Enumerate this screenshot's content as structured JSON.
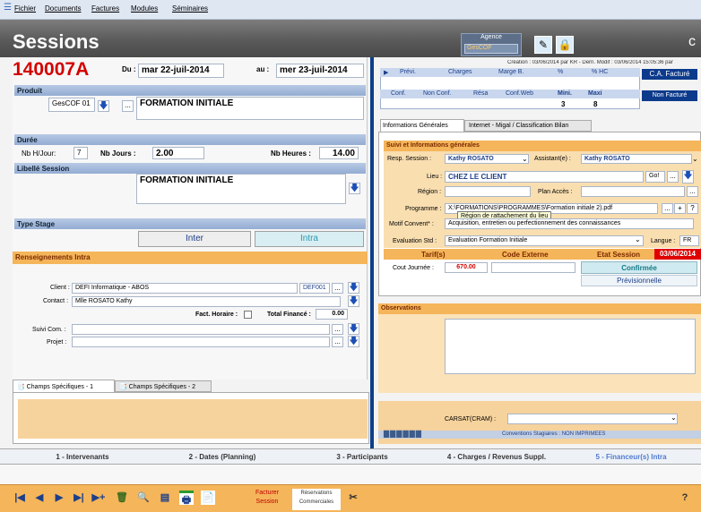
{
  "menu": {
    "items": [
      "Fichier",
      "Documents",
      "Factures",
      "Modules",
      "Séminaires"
    ]
  },
  "header": {
    "title": "Sessions",
    "agence_label": "Agence",
    "agence_value": "GesCOF"
  },
  "session": {
    "number": "140007A",
    "du_label": "Du :",
    "du_value": "mar 22-juil-2014",
    "au_label": "au :",
    "au_value": "mer 23-juil-2014"
  },
  "produit": {
    "header": "Produit",
    "code": "GesCOF 01",
    "name": "FORMATION INITIALE"
  },
  "duree": {
    "header": "Durée",
    "nbh_label": "Nb H/Jour:",
    "nbh_value": "7",
    "nbj_label": "Nb Jours :",
    "nbj_value": "2.00",
    "nbheures_label": "Nb Heures :",
    "nbheures_value": "14.00"
  },
  "libelle": {
    "header": "Libellé Session",
    "value": "FORMATION INITIALE"
  },
  "type_stage": {
    "header": "Type Stage",
    "inter": "Inter",
    "intra": "Intra"
  },
  "intra": {
    "header": "Renseignements Intra",
    "client_label": "Client :",
    "client_value": "DEFI Informatique - ABOS",
    "client_code": "DEF001",
    "contact_label": "Contact :",
    "contact_value": "Mlle ROSATO Kathy",
    "fact_label": "Fact. Horaire :",
    "total_label": "Total Financé :",
    "total_value": "0.00",
    "suivi_label": "Suivi Com. :",
    "projet_label": "Projet :"
  },
  "bottom_tabs": [
    "Champs Spécifiques - 1",
    "Champs Spécifiques - 2"
  ],
  "right": {
    "creation": "Création : 03/06/2014 par KR - Dern. Modif : 03/06/2014 15:05:36 par",
    "grid_headers": [
      "Prévi.",
      "Charges",
      "Marge B.",
      "%",
      "% HC"
    ],
    "grid2_headers": [
      "Conf.",
      "Non Conf.",
      "Résa",
      "Conf.Web",
      "Mini.",
      "Maxi"
    ],
    "mini": "3",
    "maxi": "8",
    "ca_facture": "C.A. Facturé",
    "non_facture": "Non Facturé",
    "tabs": [
      "Informations Générales",
      "Internet - Migal / Classification Bilan"
    ],
    "suivi_header": "Suivi et Informations générales",
    "resp_label": "Resp. Session :",
    "resp_value": "Kathy ROSATO",
    "assist_label": "Assistant(e) :",
    "assist_value": "Kathy ROSATO",
    "lieu_label": "Lieu :",
    "lieu_value": "CHEZ LE CLIENT",
    "go_label": "Go!",
    "region_label": "Région :",
    "plan_label": "Plan Accès :",
    "prog_label": "Programme :",
    "prog_value": "X:\\FORMATIONS\\PROGRAMMES\\Formation initiale 2).pdf",
    "tooltip": "Région de rattachement du lieu",
    "motif_label": "Motif Convent* :",
    "motif_value": "Acquisition, entretien ou perfectionnement des connaissances",
    "eval_label": "Evaluation Std :",
    "eval_value": "Evaluation Formation Initiale",
    "langue_label": "Langue :",
    "langue_value": "FR",
    "tarif_label": "Tarif(s)",
    "code_ext_label": "Code Externe",
    "etat_label": "Etat Session",
    "etat_date": "03/06/2014",
    "cout_label": "Cout Journée :",
    "cout_value": "670.00",
    "confirmee": "Confirmée",
    "previsionnelle": "Prévisionnelle",
    "obs_header": "Observations",
    "carsat_label": "CARSAT(CRAM) :",
    "conventions": "Conventions Stagiaires : NON IMPRIMEES"
  },
  "section_tabs": [
    "1 - Intervenants",
    "2 - Dates (Planning)",
    "3 - Participants",
    "4 - Charges / Revenus Suppl.",
    "5 - Financeur(s) Intra"
  ],
  "toolbar": {
    "facturer": "Facturer\nSession",
    "reservations": "Réservations\nCommerciales",
    "nav": [
      "|◀",
      "◀",
      "▶",
      "▶|",
      "▶+"
    ]
  },
  "colors": {
    "accent": "#f5b55a",
    "red": "#d40000",
    "blue_sep": "#0c3f8a"
  }
}
